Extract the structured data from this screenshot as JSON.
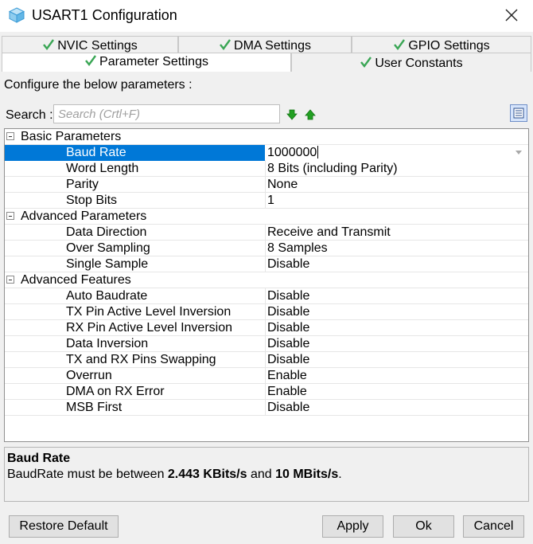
{
  "window": {
    "title": "USART1 Configuration"
  },
  "tabs": {
    "row1": [
      {
        "label": "NVIC Settings"
      },
      {
        "label": "DMA Settings"
      },
      {
        "label": "GPIO Settings"
      }
    ],
    "row2": [
      {
        "label": "Parameter Settings",
        "active": true
      },
      {
        "label": "User Constants"
      }
    ]
  },
  "content": {
    "instructions": "Configure the below parameters :",
    "search_label": "Search :",
    "search_placeholder": "Search (Crtl+F)"
  },
  "groups": [
    {
      "label": "Basic Parameters",
      "params": [
        {
          "name": "Baud Rate",
          "value": "1000000"
        },
        {
          "name": "Word Length",
          "value": "8 Bits (including Parity)"
        },
        {
          "name": "Parity",
          "value": "None"
        },
        {
          "name": "Stop Bits",
          "value": "1"
        }
      ]
    },
    {
      "label": "Advanced Parameters",
      "params": [
        {
          "name": "Data Direction",
          "value": "Receive and Transmit"
        },
        {
          "name": "Over Sampling",
          "value": "8 Samples"
        },
        {
          "name": "Single Sample",
          "value": "Disable"
        }
      ]
    },
    {
      "label": "Advanced Features",
      "params": [
        {
          "name": "Auto Baudrate",
          "value": "Disable"
        },
        {
          "name": "TX Pin Active Level Inversion",
          "value": "Disable"
        },
        {
          "name": "RX Pin Active Level Inversion",
          "value": "Disable"
        },
        {
          "name": "Data Inversion",
          "value": "Disable"
        },
        {
          "name": "TX and RX Pins Swapping",
          "value": "Disable"
        },
        {
          "name": "Overrun",
          "value": "Enable"
        },
        {
          "name": "DMA on RX Error",
          "value": "Enable"
        },
        {
          "name": "MSB First",
          "value": "Disable"
        }
      ]
    }
  ],
  "description": {
    "title": "Baud Rate",
    "prefix": "BaudRate must be between ",
    "min": "2.443 KBits/s",
    "middle": " and ",
    "max": "10 MBits/s",
    "suffix": "."
  },
  "buttons": {
    "restore": "Restore Default",
    "apply": "Apply",
    "ok": "Ok",
    "cancel": "Cancel"
  },
  "colors": {
    "selection": "#0078d7",
    "check": "#3aa655",
    "arrows": "#22a022"
  }
}
